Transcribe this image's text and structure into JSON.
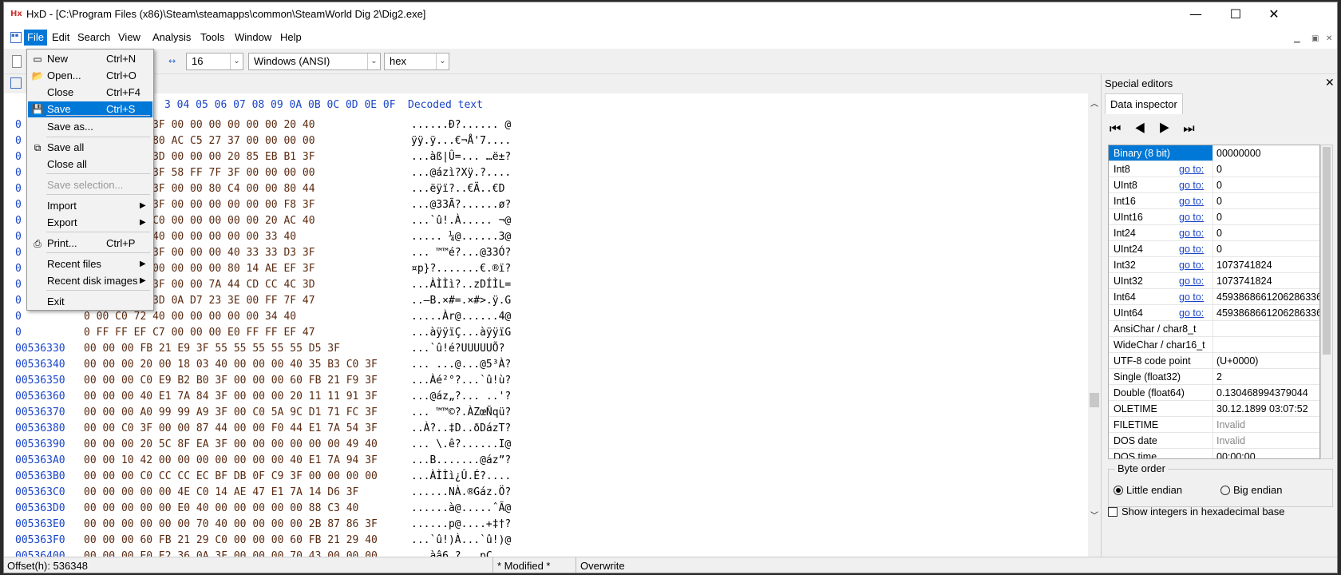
{
  "window": {
    "title": "HxD - [C:\\Program Files (x86)\\Steam\\steamapps\\common\\SteamWorld Dig 2\\Dig2.exe]",
    "minimize_glyph": "—",
    "maximize_glyph": "☐",
    "close_glyph": "✕"
  },
  "menubar": {
    "items": [
      "File",
      "Edit",
      "Search",
      "View",
      "Analysis",
      "Tools",
      "Window",
      "Help"
    ],
    "active": "File"
  },
  "toolbar": {
    "bytes_per_row": "16",
    "charset": "Windows (ANSI)",
    "display": "hex",
    "arrow_glyph": "⌄"
  },
  "file_menu": {
    "items": [
      {
        "label": "New",
        "shortcut": "Ctrl+N",
        "icon": "new-file-icon"
      },
      {
        "label": "Open...",
        "shortcut": "Ctrl+O",
        "icon": "open-folder-icon"
      },
      {
        "label": "Close",
        "shortcut": "Ctrl+F4"
      },
      {
        "label": "Save",
        "shortcut": "Ctrl+S",
        "icon": "save-icon",
        "highlighted": true
      },
      {
        "label": "Save as..."
      },
      {
        "label": "Save all",
        "icon": "save-all-icon"
      },
      {
        "label": "Close all"
      },
      {
        "label": "Save selection...",
        "disabled": true
      },
      {
        "label": "Import",
        "submenu": true
      },
      {
        "label": "Export",
        "submenu": true
      },
      {
        "label": "Print...",
        "shortcut": "Ctrl+P",
        "icon": "print-icon"
      },
      {
        "label": "Recent files",
        "submenu": true
      },
      {
        "label": "Recent disk images",
        "submenu": true
      },
      {
        "label": "Exit"
      }
    ]
  },
  "hex": {
    "header_prefix": "O",
    "header_bytes": "3 04 05 06 07 08 09 0A 0B 0C 0D 0E 0F",
    "header_decoded": "Decoded text",
    "rows": [
      {
        "offset": "0",
        "bytes": "0 00 00 D0 3F 00 00 00 00 00 00 20 40",
        "decoded": "......Ð?...... @"
      },
      {
        "offset": "0",
        "bytes": "F 00 00 00 80 AC C5 27 37 00 00 00 00",
        "decoded": "ÿÿ.ÿ...€¬Å'7...."
      },
      {
        "offset": "0",
        "bytes": "0 DF 7C DB 3D 00 00 00 20 85 EB B1 3F",
        "decoded": "...àß|Û=... …ë±?"
      },
      {
        "offset": "0",
        "bytes": "0 E1 7A EC 3F 58 FF 7F 3F 00 00 00 00",
        "decoded": "...@ázì?Xÿ.?...."
      },
      {
        "offset": "0",
        "bytes": "0 EB FF EF 3F 00 00 80 C4 00 00 80 44",
        "decoded": "...ëÿï?..€Ä..€D"
      },
      {
        "offset": "0",
        "bytes": "0 33 33 C3 3F 00 00 00 00 00 00 F8 3F",
        "decoded": "...@33Ã?......ø?"
      },
      {
        "offset": "0",
        "bytes": "0 FB 21 19 C0 00 00 00 00 00 20 AC 40",
        "decoded": "...`û!.À..... ¬@"
      },
      {
        "offset": "0",
        "bytes": "0 00 20 BC 40 00 00 00 00 00 33 40",
        "decoded": "..... ¼@......3@"
      },
      {
        "offset": "0",
        "bytes": "0 99 99 E9 3F 00 00 00 40 33 33 D3 3F",
        "decoded": "... ™™é?...@33Ó?"
      },
      {
        "offset": "0",
        "bytes": "F 00 00 00 00 00 00 00 80 14 AE EF 3F",
        "decoded": "¤p}?.......€.®ï?"
      },
      {
        "offset": "0",
        "bytes": "0 CC CC EC 3F 00 00 7A 44 CD CC 4C 3D",
        "decoded": "...ÀÌÌì?..zDÍÌL="
      },
      {
        "offset": "0",
        "bytes": "2 0A D7 23 3D 0A D7 23 3E 00 FF 7F 47",
        "decoded": "..–B.×#=.×#>.ÿ.G"
      },
      {
        "offset": "0",
        "bytes": "0 00 C0 72 40 00 00 00 00 00 34 40",
        "decoded": ".....Àr@......4@"
      },
      {
        "offset": "0",
        "bytes": "0 FF FF EF C7 00 00 00 E0 FF FF EF 47",
        "decoded": "...àÿÿïÇ...àÿÿïG"
      },
      {
        "offset": "00536330",
        "bytes": "00 00 00 FB 21 E9 3F 55 55 55 55 55 D5 3F",
        "decoded": "...`û!é?UUUUUÕ?"
      },
      {
        "offset": "00536340",
        "bytes": "00 00 00 20 00 18 03 40 00 00 00 40 35 B3 C0 3F",
        "decoded": "... ...@...@5³À?"
      },
      {
        "offset": "00536350",
        "bytes": "00 00 00 C0 E9 B2 B0 3F 00 00 00 60 FB 21 F9 3F",
        "decoded": "...Àé²°?...`û!ù?"
      },
      {
        "offset": "00536360",
        "bytes": "00 00 00 40 E1 7A 84 3F 00 00 00 20 11 11 91 3F",
        "decoded": "...@áz„?... ..'?"
      },
      {
        "offset": "00536370",
        "bytes": "00 00 00 A0 99 99 A9 3F 00 C0 5A 9C D1 71 FC 3F",
        "decoded": "... ™™©?.ÀZœÑqü?"
      },
      {
        "offset": "00536380",
        "bytes": "00 00 C0 3F 00 00 87 44 00 00 F0 44 E1 7A 54 3F",
        "decoded": "..À?..‡D..ðDázT?"
      },
      {
        "offset": "00536390",
        "bytes": "00 00 00 20 5C 8F EA 3F 00 00 00 00 00 00 49 40",
        "decoded": "... \\.ê?......I@"
      },
      {
        "offset": "005363A0",
        "bytes": "00 00 10 42 00 00 00 00 00 00 00 40 E1 7A 94 3F",
        "decoded": "...B.......@áz”?"
      },
      {
        "offset": "005363B0",
        "bytes": "00 00 00 C0 CC CC EC BF DB 0F C9 3F 00 00 00 00",
        "decoded": "...ÀÌÌì¿Û.É?...."
      },
      {
        "offset": "005363C0",
        "bytes": "00 00 00 00 00 4E C0 14 AE 47 E1 7A 14 D6 3F",
        "decoded": "......NÀ.®Gáz.Ö?"
      },
      {
        "offset": "005363D0",
        "bytes": "00 00 00 00 00 E0 40 00 00 00 00 00 88 C3 40",
        "decoded": "......à@.....ˆÃ@"
      },
      {
        "offset": "005363E0",
        "bytes": "00 00 00 00 00 00 70 40 00 00 00 00 2B 87 86 3F",
        "decoded": "......p@....+‡†?"
      },
      {
        "offset": "005363F0",
        "bytes": "00 00 00 60 FB 21 29 C0 00 00 00 60 FB 21 29 40",
        "decoded": "...`û!)À...`û!)@"
      },
      {
        "offset": "00536400",
        "bytes": "00 00 00 E0 E2 36 0A 3F 00 00 00 70 43 00 00 00",
        "decoded": "...àâ6.?...pC..."
      },
      {
        "offset": "00536410",
        "bytes": "00 00 00 00 00 54 40 00 00 00 A0 99 99 C9 3F",
        "decoded": ".......T@... ™™É?"
      },
      {
        "offset": "00536420",
        "bytes": "00 00 00 00 00 14 40 00 00 00 00 00 00 1C 40",
        "decoded": ".......@.......@"
      }
    ]
  },
  "side_panel": {
    "title": "Special editors",
    "close_glyph": "✕",
    "tab": "Data inspector",
    "nav": "⏮ ◀ ▶ ⏭",
    "goto_label": "go to:",
    "rows": [
      {
        "label": "Binary (8 bit)",
        "value": "00000000",
        "selected": true
      },
      {
        "label": "Int8",
        "goto": true,
        "value": "0"
      },
      {
        "label": "UInt8",
        "goto": true,
        "value": "0"
      },
      {
        "label": "Int16",
        "goto": true,
        "value": "0"
      },
      {
        "label": "UInt16",
        "goto": true,
        "value": "0"
      },
      {
        "label": "Int24",
        "goto": true,
        "value": "0"
      },
      {
        "label": "UInt24",
        "goto": true,
        "value": "0"
      },
      {
        "label": "Int32",
        "goto": true,
        "value": "1073741824"
      },
      {
        "label": "UInt32",
        "goto": true,
        "value": "1073741824"
      },
      {
        "label": "Int64",
        "goto": true,
        "value": "4593868661206286336"
      },
      {
        "label": "UInt64",
        "goto": true,
        "value": "4593868661206286336"
      },
      {
        "label": "AnsiChar / char8_t",
        "value": ""
      },
      {
        "label": "WideChar / char16_t",
        "value": ""
      },
      {
        "label": "UTF-8 code point",
        "value": "(U+0000)"
      },
      {
        "label": "Single (float32)",
        "value": "2"
      },
      {
        "label": "Double (float64)",
        "value": "0.130468994379044"
      },
      {
        "label": "OLETIME",
        "value": "30.12.1899 03:07:52"
      },
      {
        "label": "FILETIME",
        "value": "Invalid",
        "dim": true
      },
      {
        "label": "DOS date",
        "value": "Invalid",
        "dim": true
      },
      {
        "label": "DOS time",
        "value": "00:00:00"
      }
    ],
    "byte_order_title": "Byte order",
    "little_endian": "Little endian",
    "big_endian": "Big endian",
    "hex_checkbox": "Show integers in hexadecimal base"
  },
  "status": {
    "offset": "Offset(h): 536348",
    "modified": "* Modified *",
    "mode": "Overwrite"
  }
}
